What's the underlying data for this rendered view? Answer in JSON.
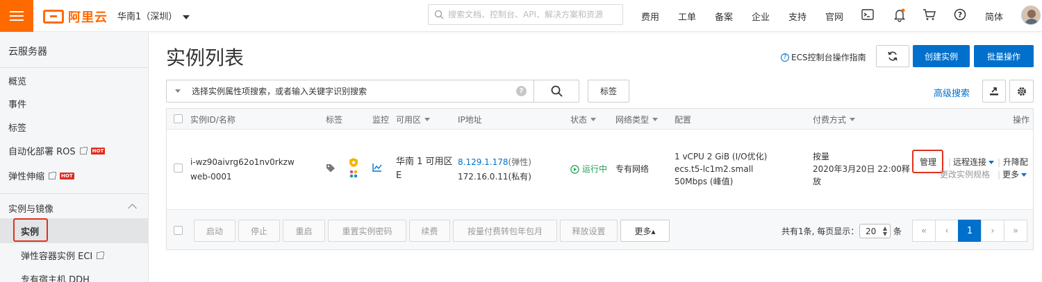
{
  "topbar": {
    "logo_text": "阿里云",
    "region": "华南1（深圳）",
    "search_placeholder": "搜索文档、控制台、API、解决方案和资源",
    "nav": [
      "费用",
      "工单",
      "备案",
      "企业",
      "支持",
      "官网"
    ],
    "language": "简体",
    "brand_color": "#ff6a00"
  },
  "sidebar": {
    "title": "云服务器",
    "items": [
      {
        "label": "概览"
      },
      {
        "label": "事件"
      },
      {
        "label": "标签"
      },
      {
        "label": "自动化部署 ROS",
        "badge": "HOT"
      },
      {
        "label": "弹性伸缩",
        "badge": "HOT"
      }
    ],
    "group": {
      "label": "实例与镜像",
      "items": [
        {
          "label": "实例",
          "active": true
        },
        {
          "label": "弹性容器实例 ECI"
        },
        {
          "label": "专有宿主机 DDH"
        }
      ]
    }
  },
  "main": {
    "title": "实例列表",
    "guide_link": "ECS控制台操作指南",
    "create_button": "创建实例",
    "batch_button": "批量操作",
    "filter_placeholder": "选择实例属性项搜索，或者输入关键字识别搜索",
    "tag_button": "标签",
    "advanced_search": "高级搜索",
    "primary_color": "#0070cc"
  },
  "table": {
    "headers": {
      "id_name": "实例ID/名称",
      "tags": "标签",
      "monitor": "监控",
      "zone": "可用区",
      "ip": "IP地址",
      "status": "状态",
      "network": "网络类型",
      "config": "配置",
      "billing": "付费方式",
      "actions": "操作"
    },
    "row": {
      "instance_id": "i-wz90aivrg62o1nv0rkzw",
      "instance_name": "web-0001",
      "zone_line1": "华南 1 可用区",
      "zone_line2": "E",
      "public_ip": "8.129.1.178",
      "public_ip_suffix": "(弹性)",
      "private_ip": "172.16.0.11(私有)",
      "status": "运行中",
      "network": "专有网络",
      "config_line1": "1 vCPU 2 GiB (I/O优化)",
      "config_type": "ecs.t5-lc1m2.small",
      "config_bandwidth": "50Mbps (峰值)",
      "billing_type": "按量",
      "billing_line2": "2020年3月20日 22:00释",
      "billing_line3": "放",
      "action_manage": "管理",
      "action_remote": "远程连接",
      "action_upgrade": "升降配",
      "action_change_spec": "更改实例规格",
      "action_more": "更多"
    },
    "footer": {
      "buttons": [
        "启动",
        "停止",
        "重启",
        "重置实例密码",
        "续费",
        "按量付费转包年包月",
        "释放设置"
      ],
      "more": "更多▴",
      "summary_prefix": "共有1条, 每页显示：",
      "page_size": "20",
      "summary_suffix": "条",
      "pages": [
        "«",
        "‹",
        "1",
        "›",
        "»"
      ]
    }
  }
}
